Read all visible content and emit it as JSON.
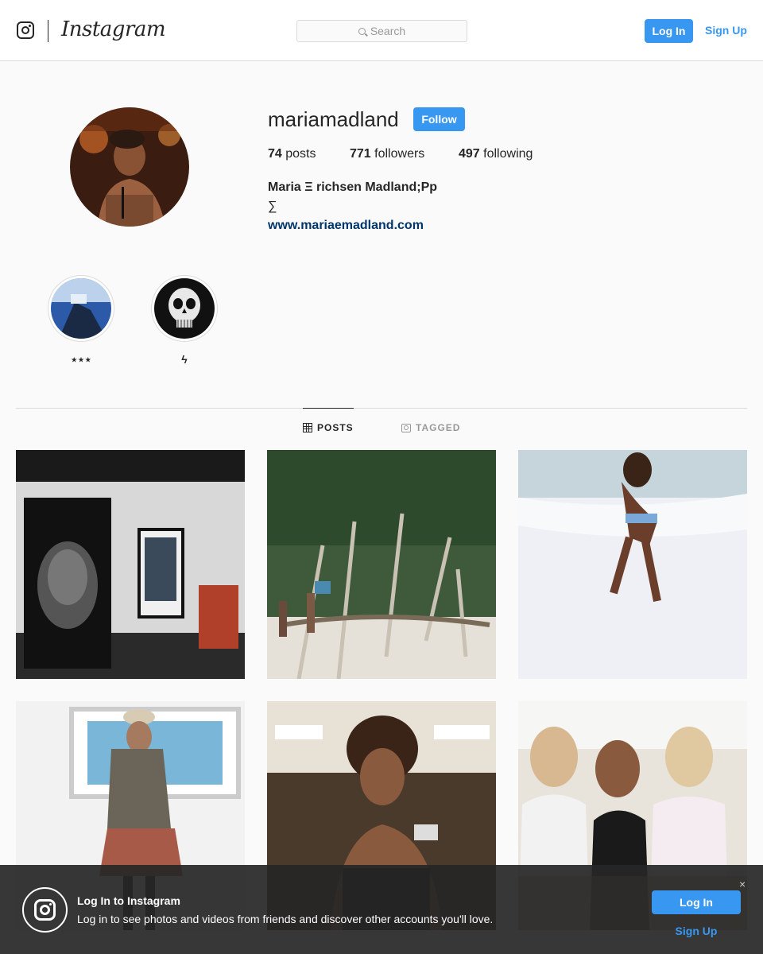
{
  "header": {
    "logo_icon": "instagram-glyph-icon",
    "wordmark": "Instagram",
    "search_placeholder": "Search",
    "search_icon": "search-icon",
    "login_label": "Log In",
    "signup_label": "Sign Up"
  },
  "profile": {
    "username": "mariamadland",
    "follow_label": "Follow",
    "posts_count": "74",
    "posts_label": "posts",
    "followers_count": "771",
    "followers_label": "followers",
    "following_count": "497",
    "following_label": "following",
    "full_name": "Maria Ξ richsen Madland;Pp",
    "bio": "∑",
    "website": "www.mariaemadland.com"
  },
  "highlights": [
    {
      "label": "⋆⋆⋆"
    },
    {
      "label": "ϟ"
    }
  ],
  "tabs": {
    "posts": "POSTS",
    "tagged": "TAGGED"
  },
  "posts_grid": [
    {
      "description": "gallery-wall-portrait"
    },
    {
      "description": "mangrove-beach"
    },
    {
      "description": "beach-shoreline"
    },
    {
      "description": "gallery-coat-portrait"
    },
    {
      "description": "cafe-portrait"
    },
    {
      "description": "friends-at-table"
    }
  ],
  "banner": {
    "title": "Log In to Instagram",
    "subtitle": "Log in to see photos and videos from friends and discover other accounts you'll love.",
    "login_label": "Log In",
    "signup_label": "Sign Up",
    "close_glyph": "×"
  },
  "colors": {
    "accent": "#3897f0",
    "link": "#003569",
    "text": "#262626",
    "muted": "#999999",
    "border": "#dbdbdb",
    "background": "#fafafa"
  }
}
